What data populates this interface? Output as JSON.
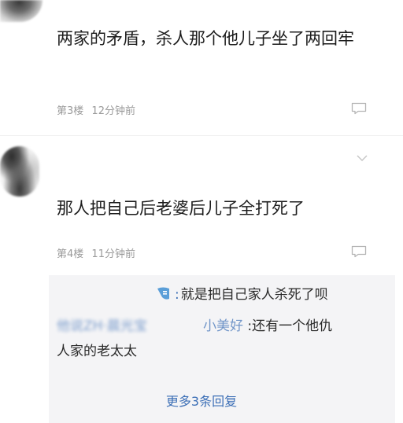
{
  "comments": [
    {
      "text": "两家的矛盾，杀人那个他儿子坐了两回牢",
      "floor": "第3楼",
      "time": "12分钟前"
    },
    {
      "text": "那人把自己后老婆后儿子全打死了",
      "floor": "第4楼",
      "time": "11分钟前",
      "replies": [
        {
          "text": "就是把自己家人杀死了呗"
        },
        {
          "author_suffix": "小美好",
          "text_line1": ":还有一个他仇",
          "text_line2": "人家的老太太"
        }
      ],
      "more_replies_label": "更多3条回复"
    }
  ],
  "icons": {
    "reply": "comment-bubble-icon",
    "expand": "chevron-down-icon"
  },
  "colors": {
    "link": "#3c6fb6",
    "meta": "#9a9a9a",
    "reply_bg": "#f4f4f6"
  }
}
